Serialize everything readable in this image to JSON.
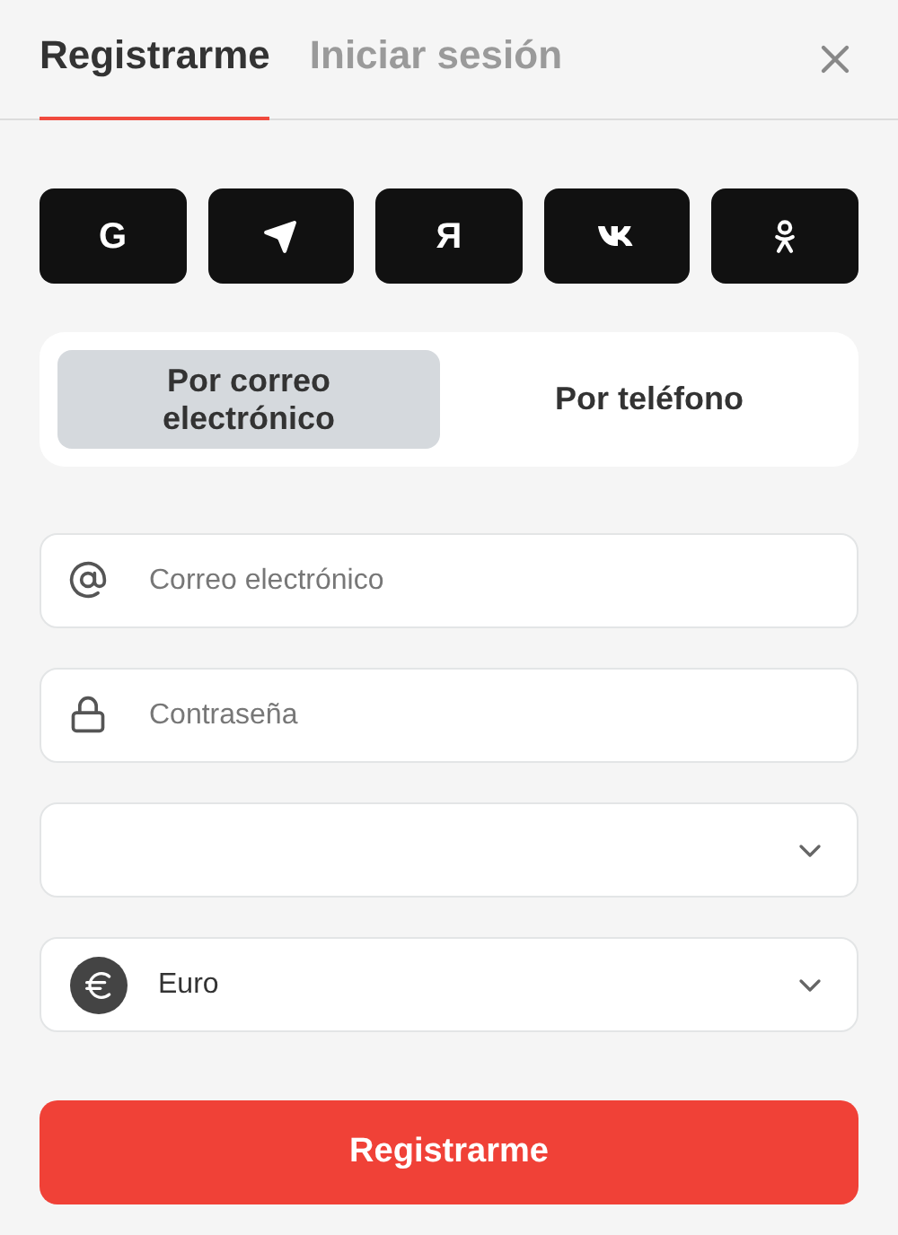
{
  "tabs": [
    {
      "label": "Registrarme",
      "selected": true
    },
    {
      "label": "Iniciar sesión",
      "selected": false
    }
  ],
  "social": [
    {
      "kind": "letter",
      "label": "G"
    },
    {
      "kind": "telegram"
    },
    {
      "kind": "letter",
      "label": "Я"
    },
    {
      "kind": "vk"
    },
    {
      "kind": "ok"
    }
  ],
  "methods": [
    {
      "label": "Por correo electrónico",
      "selected": true
    },
    {
      "label": "Por teléfono",
      "selected": false
    }
  ],
  "fields": [
    {
      "kind": "email",
      "placeholder": "Correo electrónico"
    },
    {
      "kind": "password",
      "placeholder": "Contraseña"
    },
    {
      "kind": "select"
    },
    {
      "kind": "currency",
      "value": "Euro"
    }
  ],
  "submit": "Registrarme"
}
